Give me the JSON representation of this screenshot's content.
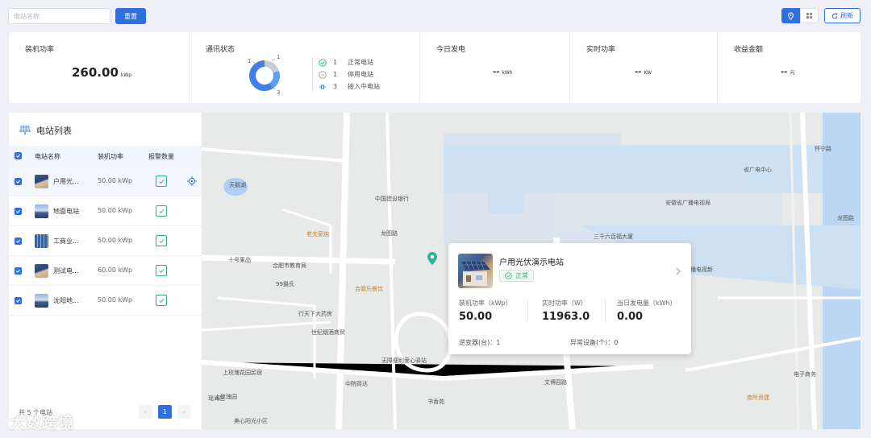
{
  "toolbar": {
    "search_placeholder": "电站名称",
    "reset_label": "重置",
    "refresh_label": "刷新"
  },
  "stats": {
    "installed": {
      "title": "装机功率",
      "value": "260.00",
      "unit": "kWp"
    },
    "comm": {
      "title": "通讯状态",
      "donut_labels": {
        "top": "1",
        "left": "1",
        "bottom": "3"
      },
      "donut": [
        {
          "name": "正常电站",
          "value": 1,
          "color": "#c7ccd5"
        },
        {
          "name": "停用电站",
          "value": 1,
          "color": "#5aa0ee"
        },
        {
          "name": "接入中电站",
          "value": 3,
          "color": "#3f7fe6"
        }
      ],
      "items": [
        {
          "count": "1",
          "label": "正常电站",
          "icon": "check-circle-icon",
          "color": "#2db37d"
        },
        {
          "count": "1",
          "label": "停用电站",
          "icon": "minus-circle-icon",
          "color": "#999999"
        },
        {
          "count": "3",
          "label": "接入中电站",
          "icon": "plug-icon",
          "color": "#2f6fe0"
        }
      ]
    },
    "today_gen": {
      "title": "今日发电",
      "value": "--",
      "unit": "kWh"
    },
    "realtime_power": {
      "title": "实时功率",
      "value": "--",
      "unit": "KW"
    },
    "income": {
      "title": "收益金额",
      "value": "--",
      "unit": "元"
    }
  },
  "station_list": {
    "title": "电站列表",
    "columns": [
      "电站名称",
      "装机功率",
      "报警数量"
    ],
    "rows": [
      {
        "name": "户用光...",
        "power": "50.00 kWp",
        "thumb": "roof"
      },
      {
        "name": "地面电站",
        "power": "50.00 kWp",
        "thumb": "sky"
      },
      {
        "name": "工商业...",
        "power": "50.00 kWp",
        "thumb": "panel"
      },
      {
        "name": "测试电...",
        "power": "60.00 kWp",
        "thumb": "roof"
      },
      {
        "name": "沈阳地...",
        "power": "50.00 kWp",
        "thumb": "sky"
      }
    ],
    "footer_label": "共 5 个电站",
    "page": "1"
  },
  "map": {
    "labels": [
      "中国建设银行",
      "龙图路",
      "安徽省广播电视局",
      "安徽广播电视新",
      "三千六百福大厦",
      "十号果品",
      "合肥市教育局",
      "99摄氏",
      "老夫家炖",
      "合徽乐餐饮",
      "行天下大药房",
      "世纪烟酒商贸",
      "无障便利爱心驿站",
      "上玫瑰花园民宿",
      "上玫瑰园",
      "书香苑",
      "中院荷达",
      "文博园路",
      "美心阳光小区",
      "天鹅湖",
      "省广电中心",
      "怀宁路",
      "龙图路",
      "电子商务",
      "南所资建",
      "小区",
      "瑶海区"
    ]
  },
  "popup": {
    "title": "户用光伏演示电站",
    "status": "正常",
    "metrics": [
      {
        "label": "装机功率（kWp）",
        "value": "50.00"
      },
      {
        "label": "实时功率（W）",
        "value": "11963.0"
      },
      {
        "label": "当日发电量（kWh）",
        "value": "0.00"
      }
    ],
    "inverter_label": "逆变器(台)：",
    "inverter_value": "1",
    "abnormal_label": "异常设备(个)：",
    "abnormal_value": "0"
  },
  "watermark": "大数跨境"
}
